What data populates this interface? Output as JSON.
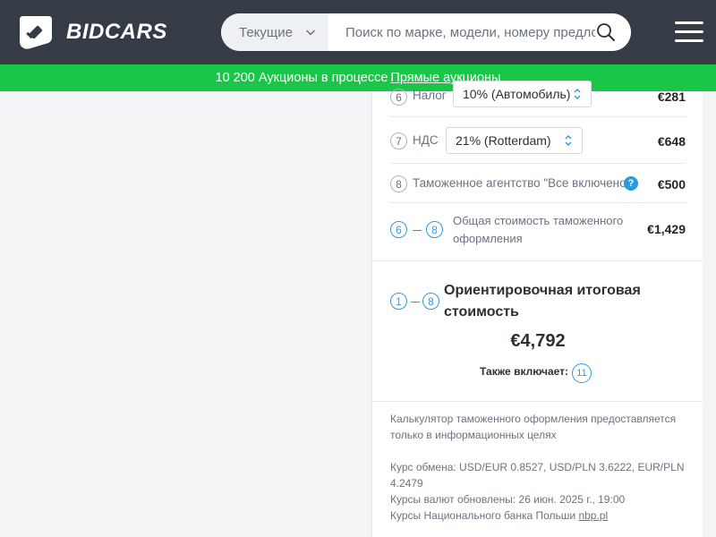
{
  "brand": {
    "name": "BIDCARS"
  },
  "search": {
    "category": "Текущие",
    "placeholder": "Поиск по марке, модели, номеру предложения"
  },
  "banner": {
    "text": "10 200 Аукционы в процессе",
    "link": "Прямые аукционы"
  },
  "rows": {
    "tax": {
      "num": "6",
      "label": "Налог",
      "select": "10% (Автомобиль)",
      "amount": "€281"
    },
    "vat": {
      "num": "7",
      "label": "НДС",
      "select": "21% (Rotterdam)",
      "amount": "€648"
    },
    "agency": {
      "num": "8",
      "label": "Таможенное агентство \"Все включено\"",
      "help": "?",
      "amount": "€500"
    },
    "customs_total": {
      "from": "6",
      "to": "8",
      "label": "Общая стоимость таможенного оформления",
      "amount": "€1,429"
    }
  },
  "total": {
    "from": "1",
    "to": "8",
    "title": "Ориентировочная итоговая стоимость",
    "amount": "€4,792",
    "includes_label": "Также включает:",
    "includes_num": "11"
  },
  "notes": {
    "disclaimer": "Калькулятор таможенного оформления предоставляется только в информационных целях",
    "rates": "Курс обмена: USD/EUR 0.8527, USD/PLN 3.6222, EUR/PLN 4.2479",
    "updated": "Курсы валют обновлены: 26 июн. 2025 г., 19:00",
    "source_label": "Курсы Национального банка Польши",
    "source_link": "nbp.pl"
  },
  "colors": {
    "header": "#353c45",
    "banner": "#1ac648",
    "accent": "#2a9ae0"
  },
  "icons": {
    "logo": "bidcars-logo-icon",
    "search": "search-icon",
    "menu": "hamburger-menu-icon",
    "chevron": "chevron-down-icon",
    "updown": "updown-arrows-icon"
  }
}
